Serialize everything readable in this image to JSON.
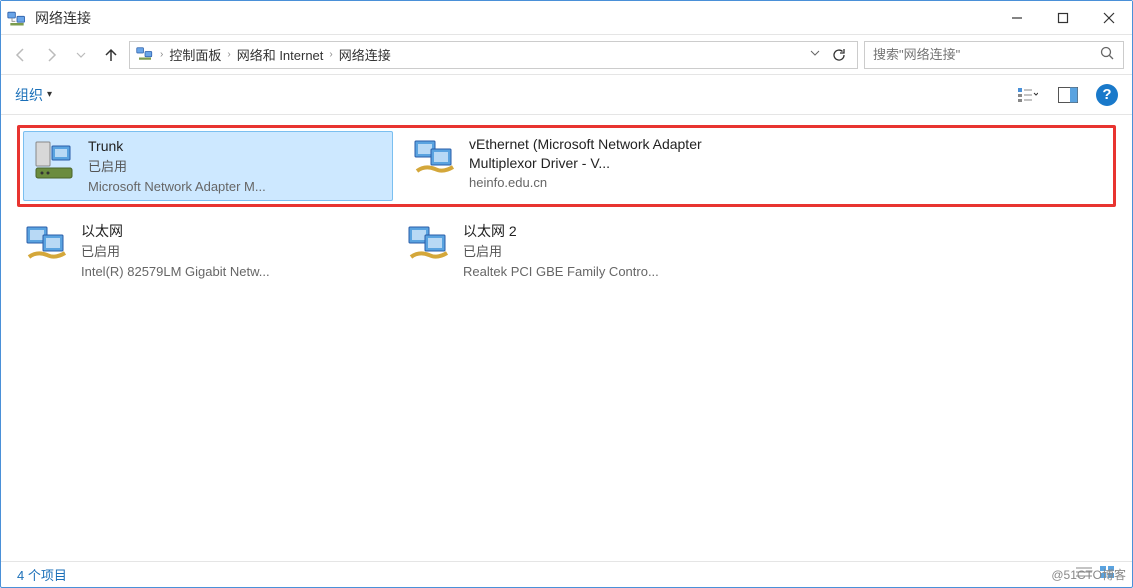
{
  "title": "网络连接",
  "breadcrumbs": [
    "控制面板",
    "网络和 Internet",
    "网络连接"
  ],
  "search": {
    "placeholder": "搜索\"网络连接\""
  },
  "toolbar": {
    "organize": "组织"
  },
  "adapters": {
    "highlighted": [
      {
        "name": "Trunk",
        "status": "已启用",
        "device": "Microsoft Network Adapter M...",
        "selected": true
      },
      {
        "name": "vEthernet (Microsoft Network Adapter Multiplexor Driver - V...",
        "status": "",
        "device": "heinfo.edu.cn",
        "selected": false,
        "multiline_name": true
      }
    ],
    "normal": [
      {
        "name": "以太网",
        "status": "已启用",
        "device": "Intel(R) 82579LM Gigabit Netw...",
        "selected": false
      },
      {
        "name": "以太网 2",
        "status": "已启用",
        "device": "Realtek PCI GBE Family Contro...",
        "selected": false
      }
    ]
  },
  "status_bar": {
    "item_count": "4 个项目"
  },
  "watermark": "@51CTO博客"
}
